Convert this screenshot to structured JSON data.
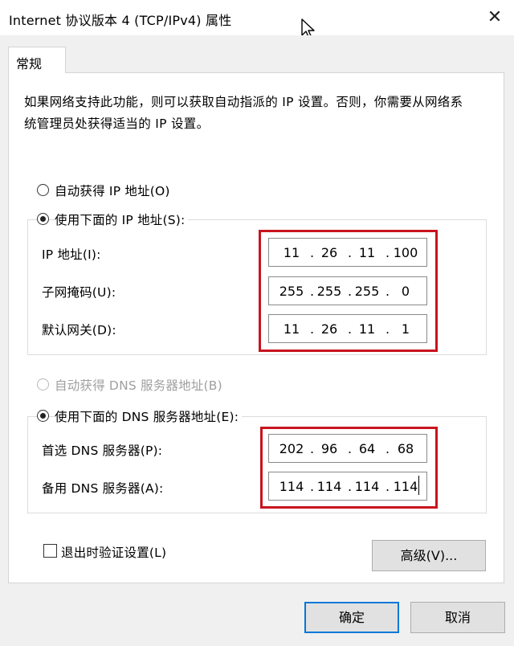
{
  "window": {
    "title": "Internet 协议版本 4 (TCP/IPv4) 属性",
    "close_glyph": "✕"
  },
  "tab": {
    "label": "常规"
  },
  "description": "如果网络支持此功能，则可以获取自动指派的 IP 设置。否则，你需要从网络系统管理员处获得适当的 IP 设置。",
  "ip": {
    "auto_label": "自动获得 IP 地址(O)",
    "manual_label": "使用下面的 IP 地址(S):",
    "mode": "manual",
    "address_label": "IP 地址(I):",
    "address": [
      "11",
      "26",
      "11",
      "100"
    ],
    "subnet_label": "子网掩码(U):",
    "subnet": [
      "255",
      "255",
      "255",
      "0"
    ],
    "gateway_label": "默认网关(D):",
    "gateway": [
      "11",
      "26",
      "11",
      "1"
    ]
  },
  "dns": {
    "auto_label": "自动获得 DNS 服务器地址(B)",
    "manual_label": "使用下面的 DNS 服务器地址(E):",
    "mode": "manual",
    "preferred_label": "首选 DNS 服务器(P):",
    "preferred": [
      "202",
      "96",
      "64",
      "68"
    ],
    "alternate_label": "备用 DNS 服务器(A):",
    "alternate": [
      "114",
      "114",
      "114",
      "114"
    ]
  },
  "validate": {
    "label": "退出时验证设置(L)",
    "checked": false
  },
  "buttons": {
    "advanced": "高级(V)...",
    "ok": "确定",
    "cancel": "取消"
  },
  "colors": {
    "highlight_box": "#c8141e",
    "default_button_border": "#0078d7"
  }
}
